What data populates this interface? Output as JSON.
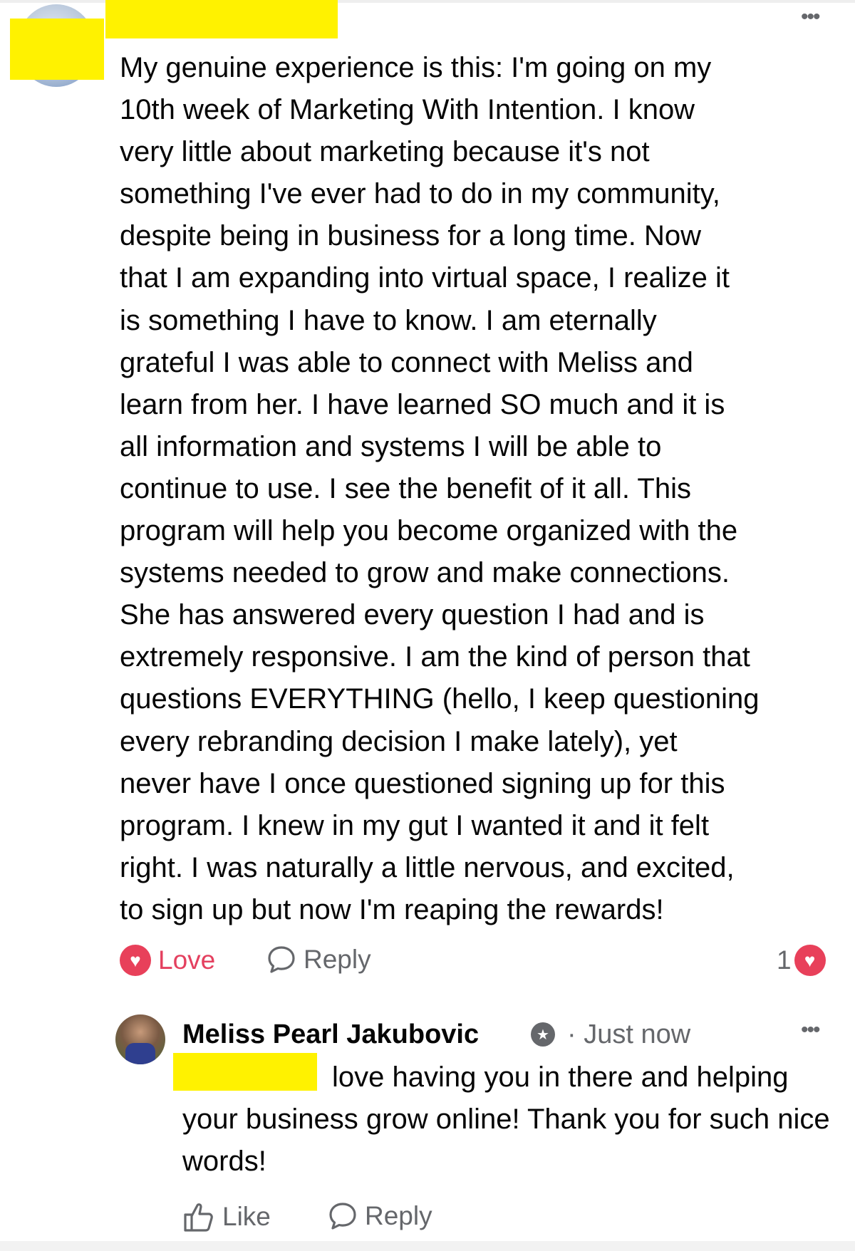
{
  "comment": {
    "text": "My genuine experience is this: I'm going on my\n10th week of Marketing With Intention. I know\nvery little about marketing because it's not\nsomething I've ever had to do in my community,\ndespite being in business for a long time. Now\nthat I am expanding into virtual space, I realize it\nis something I have to know. I am eternally\ngrateful I was able to connect with Meliss and\nlearn from her. I have learned SO much and it is\nall information and systems I will be able to\ncontinue to use. I see the benefit of it all. This\nprogram will help you become organized with the\nsystems needed to grow and make connections.\nShe has answered every question I had and is\nextremely responsive. I am the kind of person that\nquestions EVERYTHING (hello, I keep questioning\nevery rebranding decision I make lately), yet\nnever have I once questioned signing up for this\nprogram. I knew in my gut I wanted it and it felt\nright. I was naturally a little nervous, and excited,\nto sign up but now I'm reaping the rewards!",
    "love_label": "Love",
    "reply_label": "Reply",
    "reaction_count": "1",
    "more": "•••"
  },
  "reply": {
    "author": "Meliss Pearl Jakubovic",
    "time": "· Just now",
    "text": "love having you in there and helping your business grow online! Thank you for such nice words!",
    "like_label": "Like",
    "reply_label": "Reply",
    "more": "•••"
  },
  "icons": {
    "heart": "heart-icon",
    "comment": "comment-bubble-icon",
    "like": "thumbs-up-icon",
    "verified": "verified-badge-icon"
  },
  "colors": {
    "love": "#e4405f",
    "muted": "#65676b",
    "redaction": "#fff200"
  }
}
